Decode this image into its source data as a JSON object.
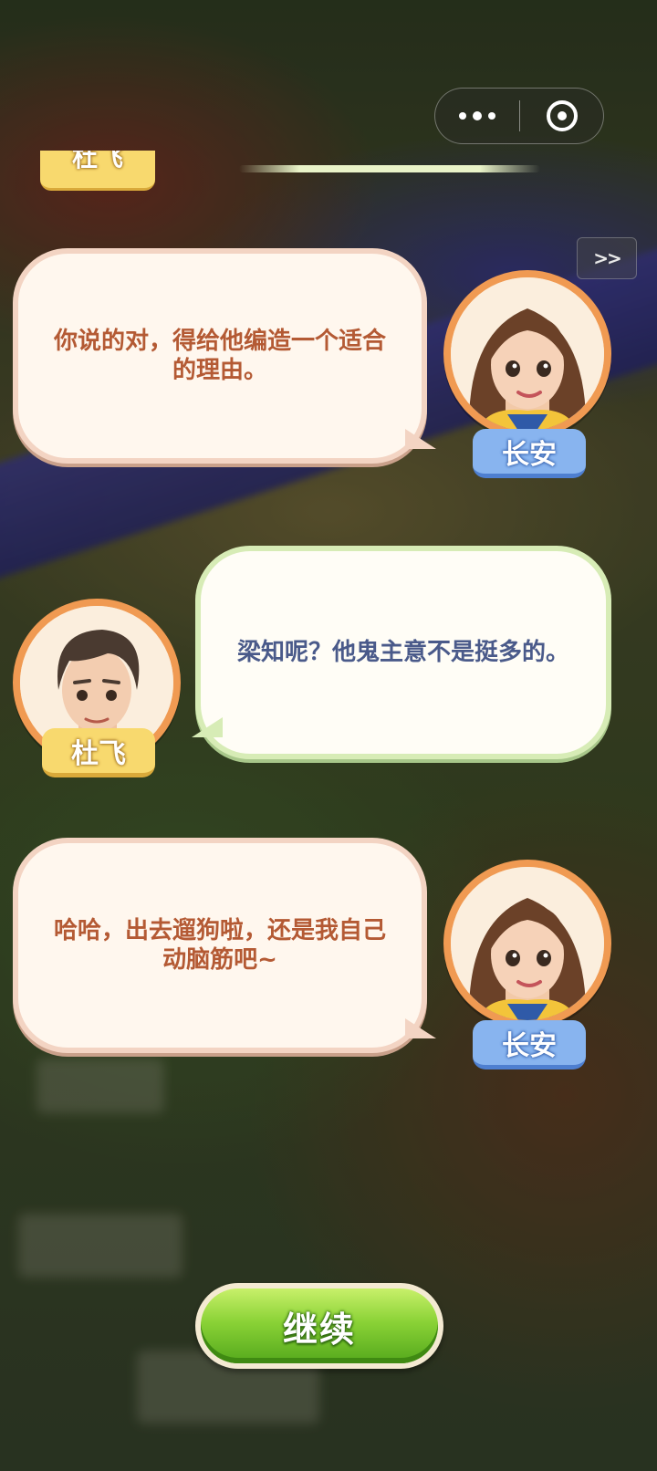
{
  "ui": {
    "skip_label": ">>",
    "continue_label": "继续",
    "previous_speaker": "杜飞"
  },
  "dialogue": [
    {
      "speaker": "长安",
      "side": "right",
      "text_line1": "你说的对，得给他编造一个适合",
      "text_line2": "的理由。"
    },
    {
      "speaker": "杜飞",
      "side": "left",
      "text_line1": "梁知呢？他鬼主意不是挺多的。",
      "text_line2": ""
    },
    {
      "speaker": "长安",
      "side": "right",
      "text_line1": "哈哈，出去遛狗啦，还是我自己",
      "text_line2": "动脑筋吧~"
    }
  ],
  "icons": {
    "menu": "more-dots-icon",
    "close": "target-circle-icon"
  },
  "colors": {
    "her_text": "#b45a34",
    "him_text": "#4a5a8a",
    "avatar_ring": "#f09a52",
    "tag_blue": "#88b4ef",
    "tag_yellow": "#f8d96e",
    "button_green": "#8ad236"
  }
}
